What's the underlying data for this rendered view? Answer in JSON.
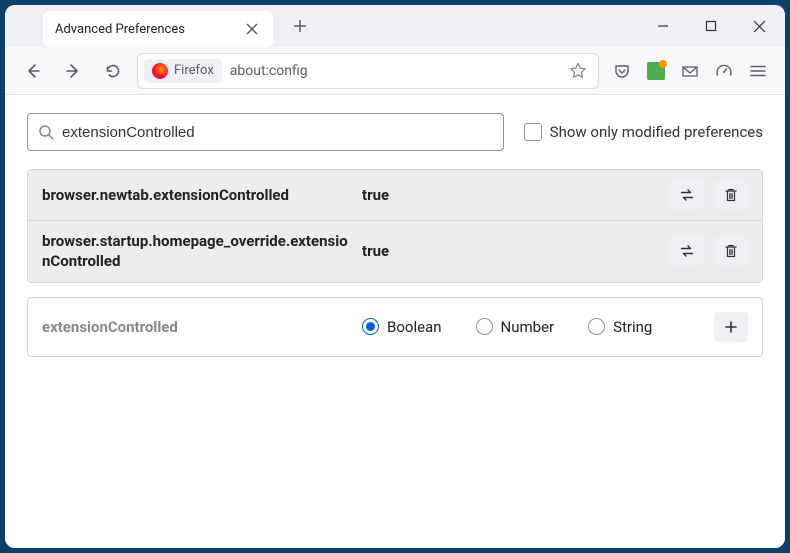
{
  "titlebar": {
    "tab_title": "Advanced Preferences"
  },
  "urlbar": {
    "identity_label": "Firefox",
    "url": "about:config"
  },
  "search": {
    "value": "extensionControlled",
    "checkbox_label": "Show only modified preferences"
  },
  "prefs": [
    {
      "name": "browser.newtab.extensionControlled",
      "value": "true"
    },
    {
      "name": "browser.startup.homepage_override.extensionControlled",
      "value": "true"
    }
  ],
  "add_row": {
    "name": "extensionControlled",
    "types": {
      "boolean": "Boolean",
      "number": "Number",
      "string": "String"
    }
  }
}
